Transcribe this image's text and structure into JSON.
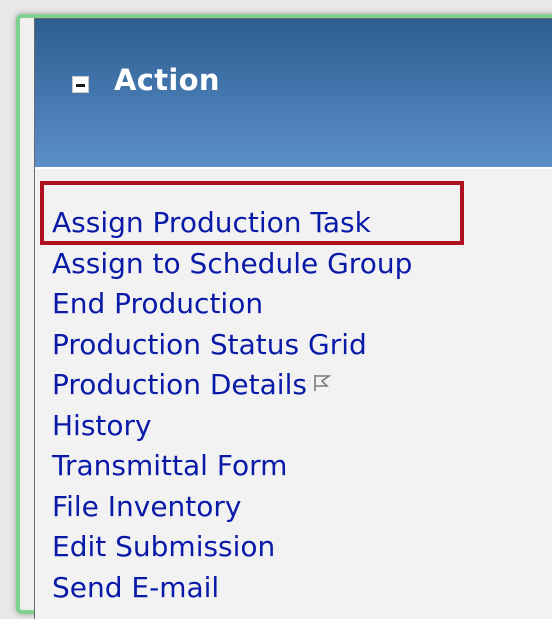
{
  "section": {
    "title": "Action",
    "toggle_icon": "minus-icon"
  },
  "actions": {
    "items": [
      {
        "label": "Assign Production Task",
        "highlighted": true
      },
      {
        "label": "Assign to Schedule Group"
      },
      {
        "label": "End Production"
      },
      {
        "label": "Production Status Grid"
      },
      {
        "label": "Production Details",
        "icon": "flag-icon"
      },
      {
        "label": "History"
      },
      {
        "label": "Transmittal Form"
      },
      {
        "label": "File Inventory"
      },
      {
        "label": "Edit Submission"
      },
      {
        "label": "Send E-mail"
      }
    ]
  },
  "colors": {
    "header_top": "#2f5e90",
    "header_bottom": "#5b8fc7",
    "link": "#0a1aa8",
    "highlight": "#b0111f",
    "frame": "#7fd18f"
  }
}
